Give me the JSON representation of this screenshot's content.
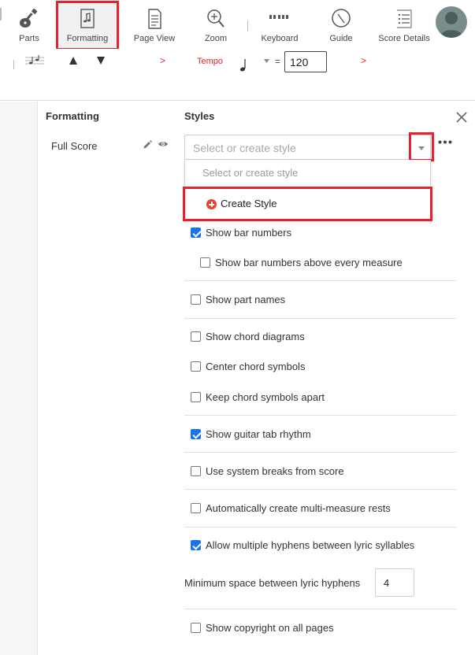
{
  "toolbar": {
    "tools": [
      {
        "id": "parts",
        "label": "Parts",
        "icon": "guitar-icon"
      },
      {
        "id": "formatting",
        "label": "Formatting",
        "icon": "score-page-icon",
        "active": true
      },
      {
        "id": "page_view",
        "label": "Page View",
        "icon": "page-view-icon"
      },
      {
        "id": "zoom",
        "label": "Zoom",
        "icon": "zoom-icon"
      },
      {
        "id": "keyboard",
        "label": "Keyboard",
        "icon": "keyboard-icon"
      },
      {
        "id": "guide",
        "label": "Guide",
        "icon": "compass-icon"
      },
      {
        "id": "score_details",
        "label": "Score Details",
        "icon": "list-icon"
      }
    ],
    "avatar_icon": "user-avatar-icon"
  },
  "secondary_bar": {
    "tempo_label": "Tempo",
    "equals": "=",
    "tempo_value": "120",
    "chevron": ">"
  },
  "formatting_panel": {
    "title": "Formatting",
    "item": "Full Score"
  },
  "styles_panel": {
    "title": "Styles",
    "select_placeholder": "Select or create style",
    "dropdown": {
      "placeholder_option": "Select or create style",
      "create_option": "Create Style"
    },
    "options": [
      {
        "label": "Show bar numbers",
        "checked": true
      },
      {
        "label": "Show bar numbers above every measure",
        "checked": false
      },
      {
        "label": "Show part names",
        "checked": false
      },
      {
        "label": "Show chord diagrams",
        "checked": false
      },
      {
        "label": "Center chord symbols",
        "checked": false
      },
      {
        "label": "Keep chord symbols apart",
        "checked": false
      },
      {
        "label": "Show guitar tab rhythm",
        "checked": true
      },
      {
        "label": "Use system breaks from score",
        "checked": false
      },
      {
        "label": "Automatically create multi-measure rests",
        "checked": false
      },
      {
        "label": "Allow multiple hyphens between lyric syllables",
        "checked": true
      },
      {
        "label": "Show copyright on all pages",
        "checked": false
      }
    ],
    "min_hyphen_label": "Minimum space between lyric hyphens",
    "min_hyphen_value": "4"
  },
  "colors": {
    "highlight_red": "#e8212c",
    "accent_blue": "#1a73e8",
    "create_icon_red": "#e8432c"
  }
}
